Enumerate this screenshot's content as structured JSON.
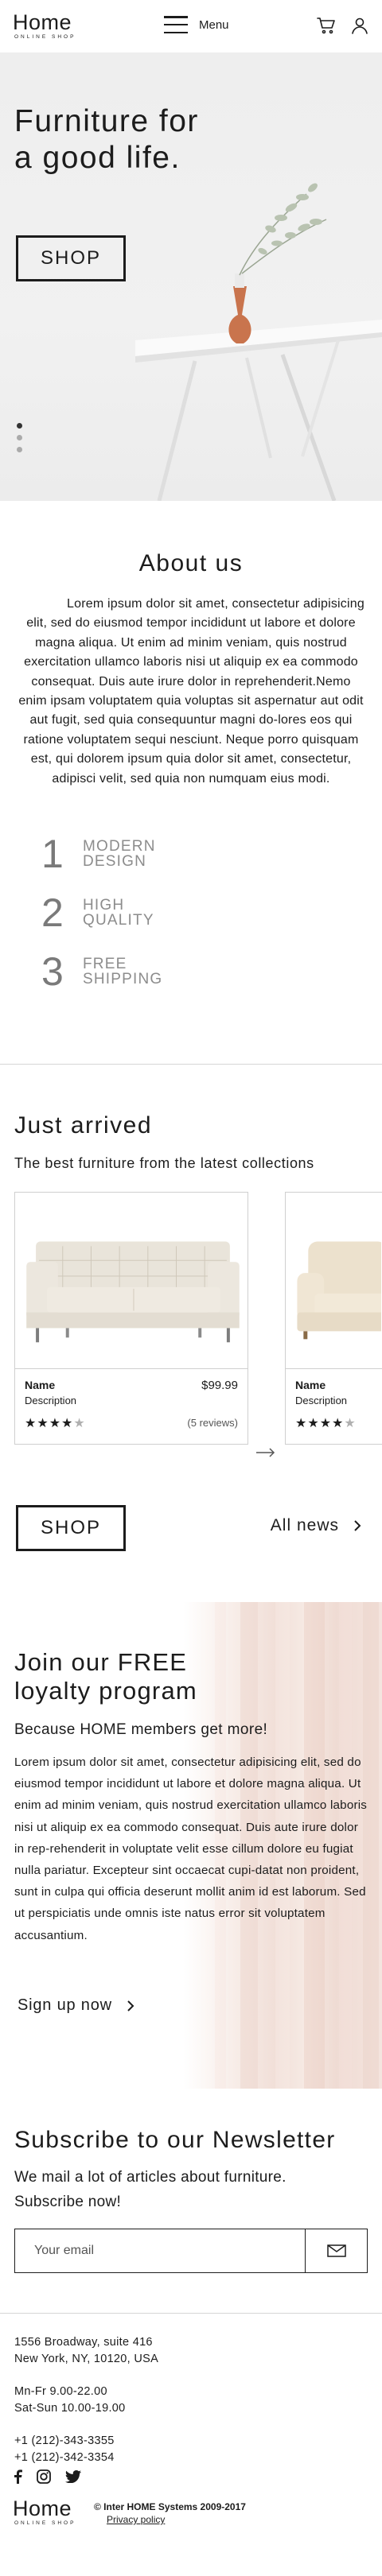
{
  "header": {
    "logo_name": "Home",
    "logo_sub": "ONLINE SHOP",
    "menu_label": "Menu",
    "icons": [
      "cart-icon",
      "user-icon"
    ]
  },
  "hero": {
    "title_line1": "Furniture for",
    "title_line2": "a good life.",
    "button": "SHOP",
    "slides": 3,
    "active_slide": 1
  },
  "about": {
    "title": "About us",
    "text": "Lorem ipsum dolor sit amet, consectetur adipisicing elit, sed do eiusmod tempor incididunt ut labore et dolore magna aliqua. Ut enim ad minim veniam, quis nostrud exercitation ullamco laboris nisi ut aliquip ex ea commodo consequat. Duis aute irure dolor in reprehenderit.Nemo enim ipsam voluptatem quia voluptas sit aspernatur aut odit aut fugit, sed quia consequuntur magni do-lores eos qui ratione voluptatem sequi nesciunt. Neque porro quisquam est, qui dolorem ipsum quia dolor sit amet, consectetur, adipisci velit, sed quia non numquam eius modi.",
    "features": [
      {
        "num": "1",
        "line1": "MODERN",
        "line2": "DESIGN"
      },
      {
        "num": "2",
        "line1": "HIGH",
        "line2": "QUALITY"
      },
      {
        "num": "3",
        "line1": "FREE",
        "line2": "SHIPPING"
      }
    ]
  },
  "arrivals": {
    "title": "Just arrived",
    "subtitle": "The best furniture from the latest collections",
    "products": [
      {
        "name": "Name",
        "description": "Description",
        "price": "$99.99",
        "rating": 4,
        "reviews": "(5 reviews)"
      },
      {
        "name": "Name",
        "description": "Description",
        "rating": 4
      }
    ],
    "shop_button": "SHOP",
    "all_news": "All news"
  },
  "loyalty": {
    "title_line1": "Join our FREE",
    "title_line2": "loyalty program",
    "subtitle": "Because HOME members get more!",
    "text": "Lorem ipsum dolor sit amet, consectetur adipisicing elit, sed do eiusmod tempor incididunt ut labore et dolore magna aliqua. Ut enim ad minim veniam, quis nostrud exercitation ullamco laboris nisi ut aliquip ex ea commodo consequat. Duis aute irure dolor in rep-rehenderit in voluptate velit esse cillum dolore eu fugiat nulla pariatur. Excepteur sint occaecat cupi-datat non proident, sunt in culpa qui officia deserunt mollit anim id est laborum. Sed ut perspiciatis unde omnis iste natus error sit voluptatem accusantium.",
    "signup": "Sign up now"
  },
  "newsletter": {
    "title": "Subscribe to our Newsletter",
    "text": "We mail a lot of articles about furniture. Subscribe now!",
    "placeholder": "Your email"
  },
  "footer": {
    "address_line1": "1556 Broadway, suite 416",
    "address_line2": "New York, NY, 10120, USA",
    "hours_line1": "Mn-Fr 9.00-22.00",
    "hours_line2": "Sat-Sun 10.00-19.00",
    "phone1": "+1 (212)-343-3355",
    "phone2": "+1 (212)-342-3354",
    "social": [
      "facebook-icon",
      "instagram-icon",
      "twitter-icon"
    ],
    "logo_name": "Home",
    "logo_sub": "ONLINE SHOP",
    "copyright": "© Inter HOME Systems 2009-2017",
    "privacy": "Privacy policy"
  }
}
